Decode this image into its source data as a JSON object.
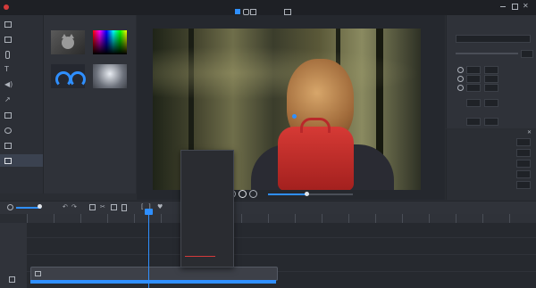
{
  "title_bar": {
    "app_menu_label": "",
    "menus": [
      "",
      "",
      "",
      "",
      ""
    ],
    "window_title": "",
    "tool_labels": [
      "",
      ""
    ],
    "window_buttons": [
      "minimize",
      "maximize",
      "close"
    ],
    "accent": "#d43a3a"
  },
  "left_sidebar": {
    "items": [
      "",
      "",
      "",
      "",
      "",
      "",
      "",
      "",
      "",
      ""
    ],
    "active_index": 9,
    "active_color": "#3b4250"
  },
  "effects_panel": {
    "header": "",
    "thumbnails": [
      {
        "label": "",
        "icon": "cat-thumbnail"
      },
      {
        "label": "",
        "icon": "color-gradient-thumbnail"
      },
      {
        "label": "",
        "icon": "rainbow-arc-thumbnail"
      },
      {
        "label": "",
        "icon": "light-rays-thumbnail"
      }
    ]
  },
  "preview": {
    "time_current": "",
    "time_total": "",
    "progress": 0.45
  },
  "properties_panel": {
    "filename": "",
    "section_labels": [
      "",
      "",
      "",
      "",
      ""
    ],
    "bottom_header": "",
    "bottom_rows": [
      "",
      "",
      "",
      "",
      ""
    ]
  },
  "context_menu": {
    "items": [
      {
        "label": "",
        "shortcut": ""
      },
      {
        "label": "",
        "shortcut": ""
      },
      {
        "label": "",
        "shortcut": ""
      },
      {
        "label": "",
        "shortcut": ""
      },
      {
        "label": "",
        "shortcut": ""
      },
      {
        "label": "",
        "shortcut": ""
      },
      {
        "label": "",
        "shortcut": ""
      },
      {
        "label": "",
        "shortcut": ""
      },
      {
        "label": "",
        "shortcut": ""
      },
      {
        "label": "",
        "shortcut": ""
      },
      {
        "label": "",
        "shortcut": ""
      },
      {
        "label": "",
        "shortcut": ""
      },
      {
        "label": "",
        "shortcut": ""
      },
      {
        "label": "",
        "shortcut": ""
      }
    ],
    "highlight_color": "#d43a3a",
    "highlight_index": 12
  },
  "timeline": {
    "zoom_label": "",
    "clip_name": "",
    "clip_color": "#3d4048",
    "track_icon": "",
    "playhead_color": "#2f8fff"
  },
  "colors": {
    "bg": "#2a2d33",
    "panel": "#30333a",
    "accent_blue": "#2f8fff",
    "accent_red": "#d43a3a"
  }
}
